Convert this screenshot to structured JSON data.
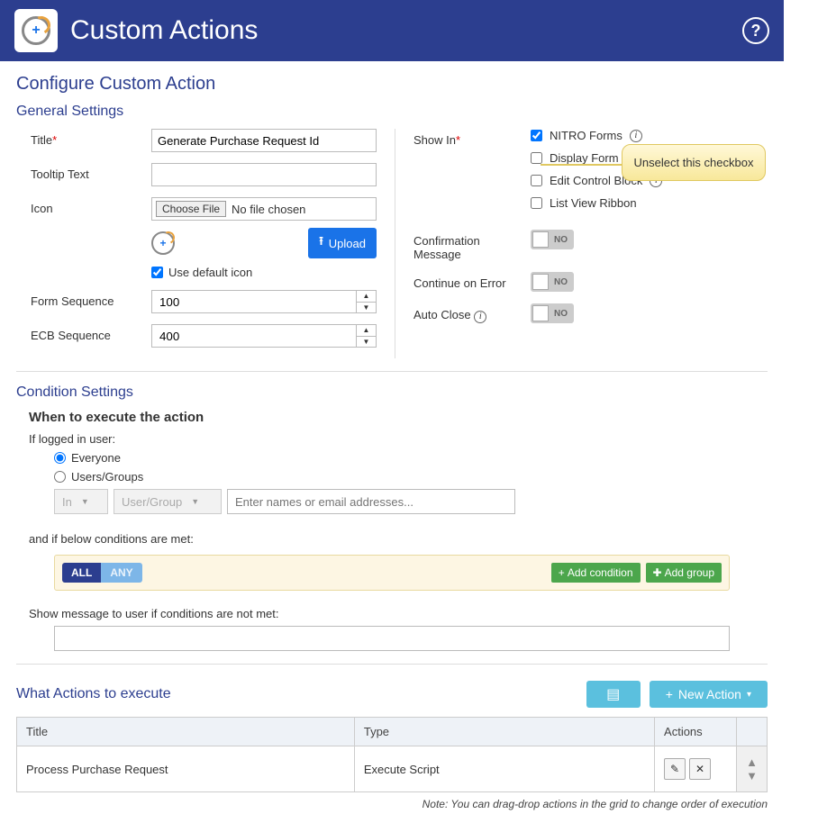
{
  "header": {
    "title": "Custom Actions"
  },
  "page_title": "Configure Custom Action",
  "general": {
    "heading": "General Settings",
    "title_label": "Title",
    "title_value": "Generate Purchase Request Id",
    "tooltip_label": "Tooltip Text",
    "tooltip_value": "",
    "icon_label": "Icon",
    "choose_file": "Choose File",
    "no_file": "No file chosen",
    "upload": "Upload",
    "use_default": "Use default icon",
    "form_seq_label": "Form Sequence",
    "form_seq_value": "100",
    "ecb_seq_label": "ECB Sequence",
    "ecb_seq_value": "400",
    "show_in_label": "Show In",
    "show_in": {
      "nitro": "NITRO Forms",
      "display": "Display Form",
      "ecb": "Edit Control Block",
      "ribbon": "List View Ribbon"
    },
    "confirm_label": "Confirmation Message",
    "continue_label": "Continue on Error",
    "autoclose_label": "Auto Close",
    "toggle_no": "NO"
  },
  "condition": {
    "heading": "Condition Settings",
    "when": "When to execute the action",
    "if_user": "If logged in user:",
    "everyone": "Everyone",
    "usersgroups": "Users/Groups",
    "in": "In",
    "usergroup": "User/Group",
    "names_placeholder": "Enter names or email addresses...",
    "and_if": "and if below conditions are met:",
    "all": "ALL",
    "any": "ANY",
    "add_condition": "Add condition",
    "add_group": "Add group",
    "show_msg": "Show message to user if conditions are not met:"
  },
  "actions": {
    "heading": "What Actions to execute",
    "new_action": "New Action",
    "cols": {
      "title": "Title",
      "type": "Type",
      "actions": "Actions"
    },
    "rows": [
      {
        "title": "Process Purchase Request",
        "type": "Execute Script"
      }
    ],
    "note": "Note: You can drag-drop actions in the grid to change order of execution"
  },
  "callout": "Unselect this checkbox"
}
